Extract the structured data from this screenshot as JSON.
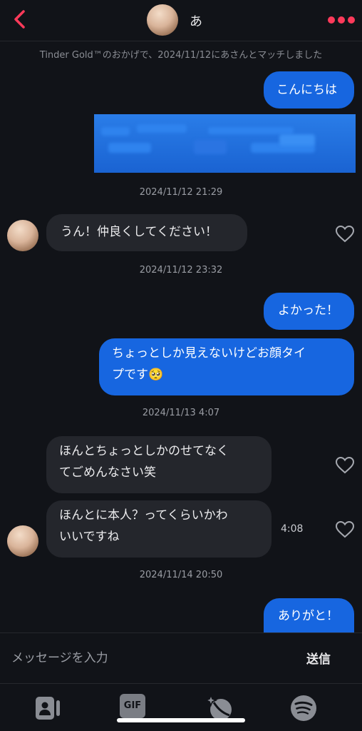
{
  "header": {
    "contact_name": "あ",
    "back_icon": "chevron-left-icon",
    "more_icon": "more-dots-icon"
  },
  "match_notice": "Tinder Gold™のおかげで、2024/11/12にあさんとマッチしました",
  "messages": [
    {
      "direction": "out",
      "text": "こんにちは"
    },
    {
      "direction": "out",
      "text": "",
      "blurred": true
    },
    {
      "direction": "in",
      "text": "うん！仲良くしてください！"
    },
    {
      "direction": "out",
      "text": "よかった！"
    },
    {
      "direction": "out",
      "text": "ちょっとしか見えないけどお顔タイプです🥺"
    },
    {
      "direction": "in",
      "text": "ほんとちょっとしかのせてなくてごめんなさい笑"
    },
    {
      "direction": "in",
      "text": "ほんとに本人？ってくらいかわいいですね"
    },
    {
      "direction": "out",
      "text": "ありがと！"
    }
  ],
  "message_lines": {
    "m4_line1": "ちょっとしか見えないけどお顔タイ",
    "m4_line2": "プです🥺",
    "m5_line1": "ほんとちょっとしかのせてなく",
    "m5_line2": "てごめんなさい笑",
    "m6_line1": "ほんとに本人？ってくらいかわ",
    "m6_line2": "いいですね"
  },
  "timestamps": [
    "2024/11/12 21:29",
    "2024/11/12 23:32",
    "2024/11/13 4:07",
    "2024/11/14 20:50"
  ],
  "side_time": "4:08",
  "composer": {
    "placeholder": "メッセージを入力",
    "send_label": "送信"
  },
  "toolbar": {
    "gif_label": "GIF",
    "items": [
      "contact-card-icon",
      "gif-icon",
      "sparkle-ball-icon",
      "spotify-icon"
    ]
  },
  "colors": {
    "accent": "#fd3a5a",
    "outgoing_bubble": "#1766e0",
    "incoming_bubble": "#24262c",
    "background": "#111318"
  }
}
